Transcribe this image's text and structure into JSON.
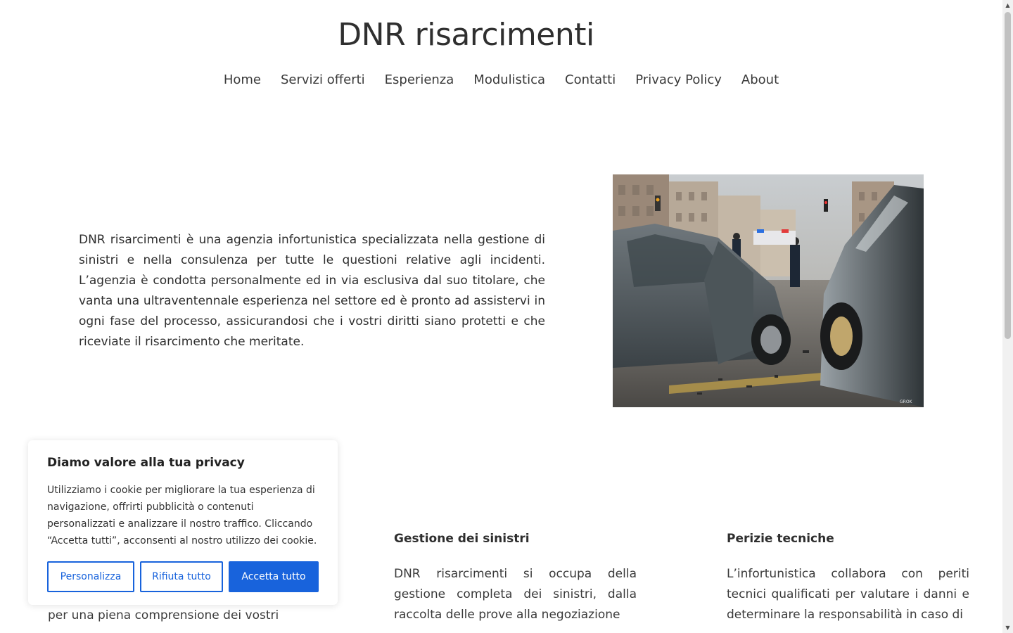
{
  "header": {
    "site_title": "DNR risarcimenti",
    "nav": [
      "Home",
      "Servizi offerti",
      "Esperienza",
      "Modulistica",
      "Contatti",
      "Privacy Policy",
      "About"
    ]
  },
  "intro": {
    "text": "DNR risarcimenti è una agenzia infortunistica specializzata nella gestione di sinistri e nella consulenza per tutte le questioni relative agli incidenti. L’agenzia è condotta personalmente ed in via esclusiva dal suo titolare, che vanta una ultraventennale esperienza nel settore ed è pronto ad assistervi in ogni fase del processo, assicurandosi che i vostri diritti siano protetti e che riceviate il risarcimento che meritate."
  },
  "services": {
    "left_partial": "per una piena  comprensione dei vostri",
    "gestione": {
      "title": "Gestione dei sinistri",
      "text": "DNR risarcimenti si occupa della gestione completa dei sinistri, dalla raccolta delle prove alla negoziazione"
    },
    "perizie": {
      "title": "Perizie tecniche",
      "text": "L’infortunistica collabora con periti tecnici qualificati per valutare i danni e determinare la responsabilità in caso di"
    }
  },
  "cookie": {
    "title": "Diamo valore alla tua privacy",
    "text": "Utilizziamo i cookie per migliorare la tua esperienza di navigazione, offrirti pubblicità o contenuti personalizzati e analizzare il nostro traffico. Cliccando “Accetta tutti”, acconsenti al nostro utilizzo dei cookie.",
    "customize": "Personalizza",
    "reject": "Rifiuta tutto",
    "accept": "Accetta tutto"
  },
  "image": {
    "watermark": "GROK"
  },
  "colors": {
    "accent": "#1863dc"
  }
}
